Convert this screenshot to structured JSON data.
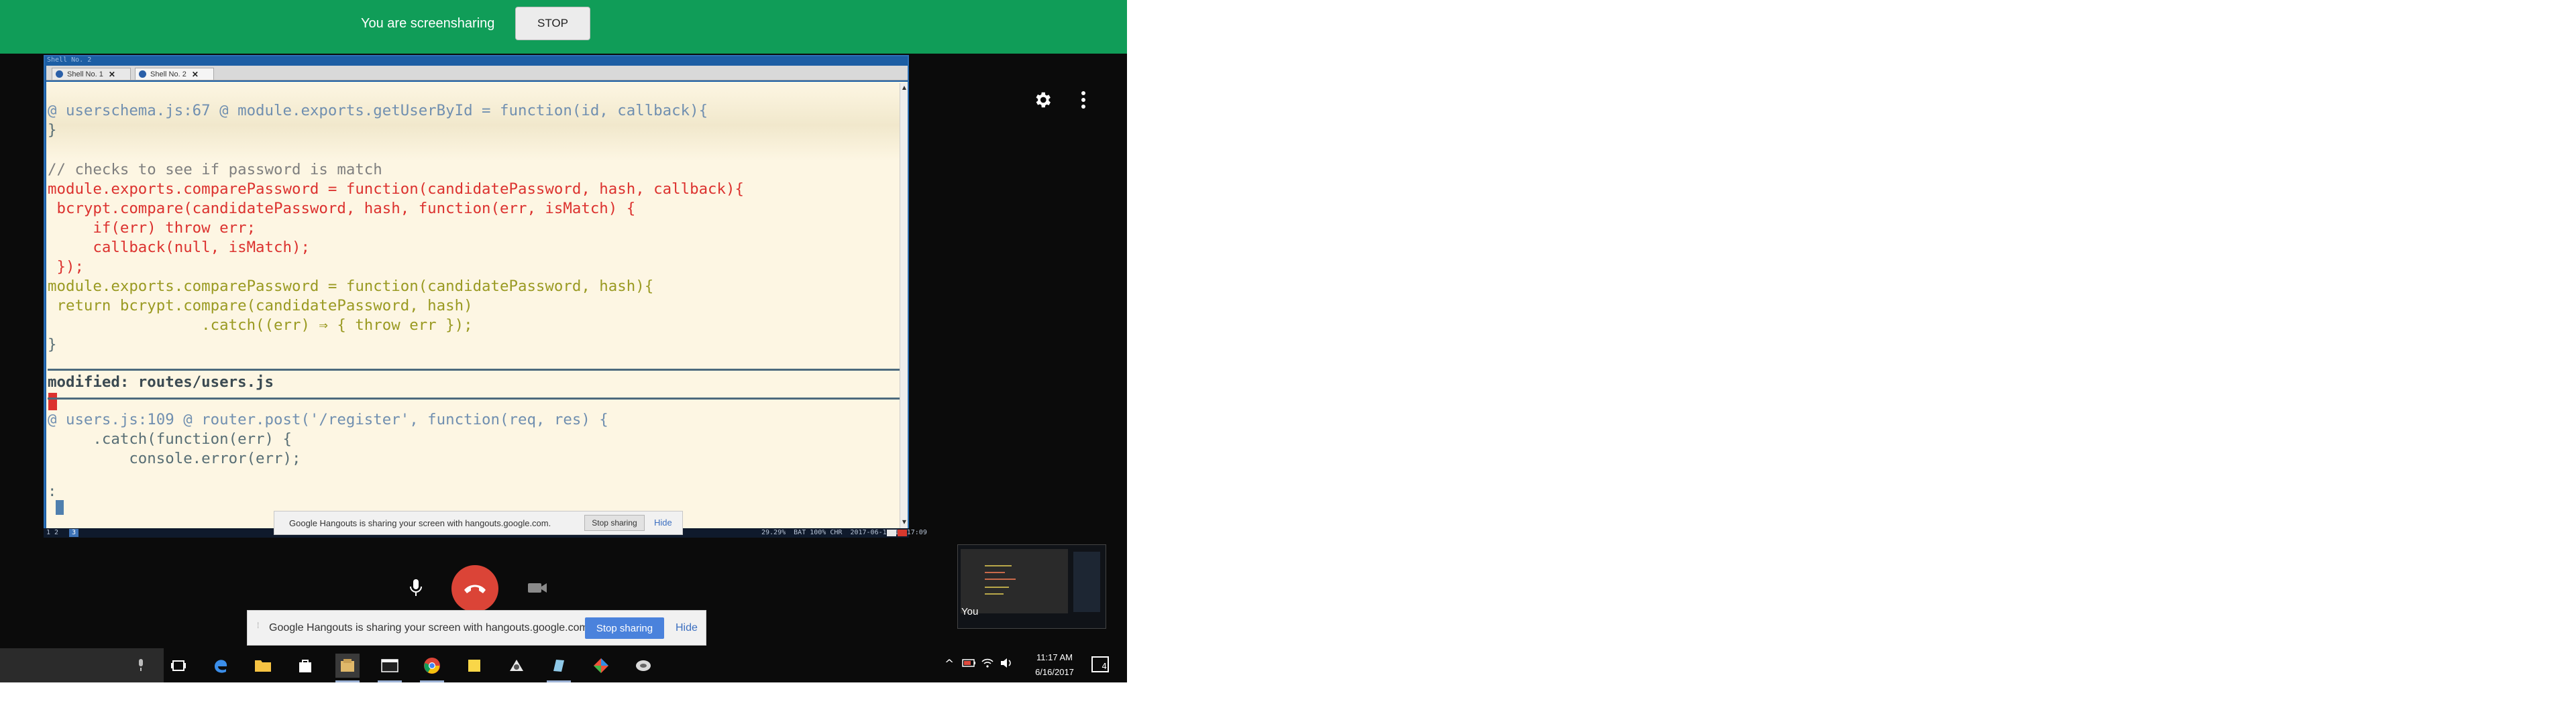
{
  "banner": {
    "message": "You are screensharing",
    "stop_label": "STOP",
    "color": "#109d58"
  },
  "top_controls": {
    "settings_icon": "gear-icon",
    "more_icon": "more-vert-icon"
  },
  "terminal": {
    "title": "Shell No. 2",
    "tabs": [
      {
        "label": "Shell No. 1",
        "close": "✕"
      },
      {
        "label": "Shell No. 2",
        "close": "✕"
      }
    ],
    "lines": {
      "hunk1": "@ userschema.js:67 @ module.exports.getUserById = function(id, callback){",
      "brace1": "}",
      "comment": "// checks to see if password is match",
      "del1": "module.exports.comparePassword = function(candidatePassword, hash, callback){",
      "del2": " bcrypt.compare(candidatePassword, hash, function(err, isMatch) {",
      "del3": "     if(err) throw err;",
      "del4": "     callback(null, isMatch);",
      "del5": " });",
      "add1": "module.exports.comparePassword = function(candidatePassword, hash){",
      "add2": " return bcrypt.compare(candidatePassword, hash)",
      "add3": "                 .catch((err) ⇒ { throw err });",
      "brace2": "}",
      "modified": "modified: routes/users.js",
      "hunk2": "@ users.js:109 @ router.post('/register', function(req, res) {",
      "ctx1": "     .catch(function(err) {",
      "ctx2": "         console.error(err);",
      "prompt": ":"
    },
    "status_left": "1 2",
    "status_num": "3",
    "status_right": "29.29%  BAT 100% CHR  2017-06-16 15:17:09"
  },
  "inner_share_bar": {
    "message": "Google Hangouts is sharing your screen with hangouts.google.com.",
    "stop_label": "Stop sharing",
    "hide_label": "Hide"
  },
  "call_controls": {
    "mic_icon": "microphone-icon",
    "hangup_icon": "hangup-icon",
    "camera_icon": "camera-off-icon",
    "hangup_color": "#db4437"
  },
  "self_view": {
    "label": "You"
  },
  "bottom_share_bar": {
    "message": "Google Hangouts is sharing your screen with hangouts.google.com.",
    "stop_label": "Stop sharing",
    "hide_label": "Hide",
    "stop_color": "#4a82dc"
  },
  "taskbar": {
    "search_mic_icon": "microphone-icon",
    "apps": [
      "task-view-icon",
      "edge-icon",
      "file-explorer-icon",
      "store-icon",
      "files-app-icon",
      "terminal-icon",
      "chrome-icon",
      "sticky-notes-icon",
      "app-icon-1",
      "app-icon-2",
      "git-icon",
      "app-icon-3"
    ],
    "time": "11:17 AM",
    "date": "6/16/2017",
    "notification_count": "4"
  }
}
